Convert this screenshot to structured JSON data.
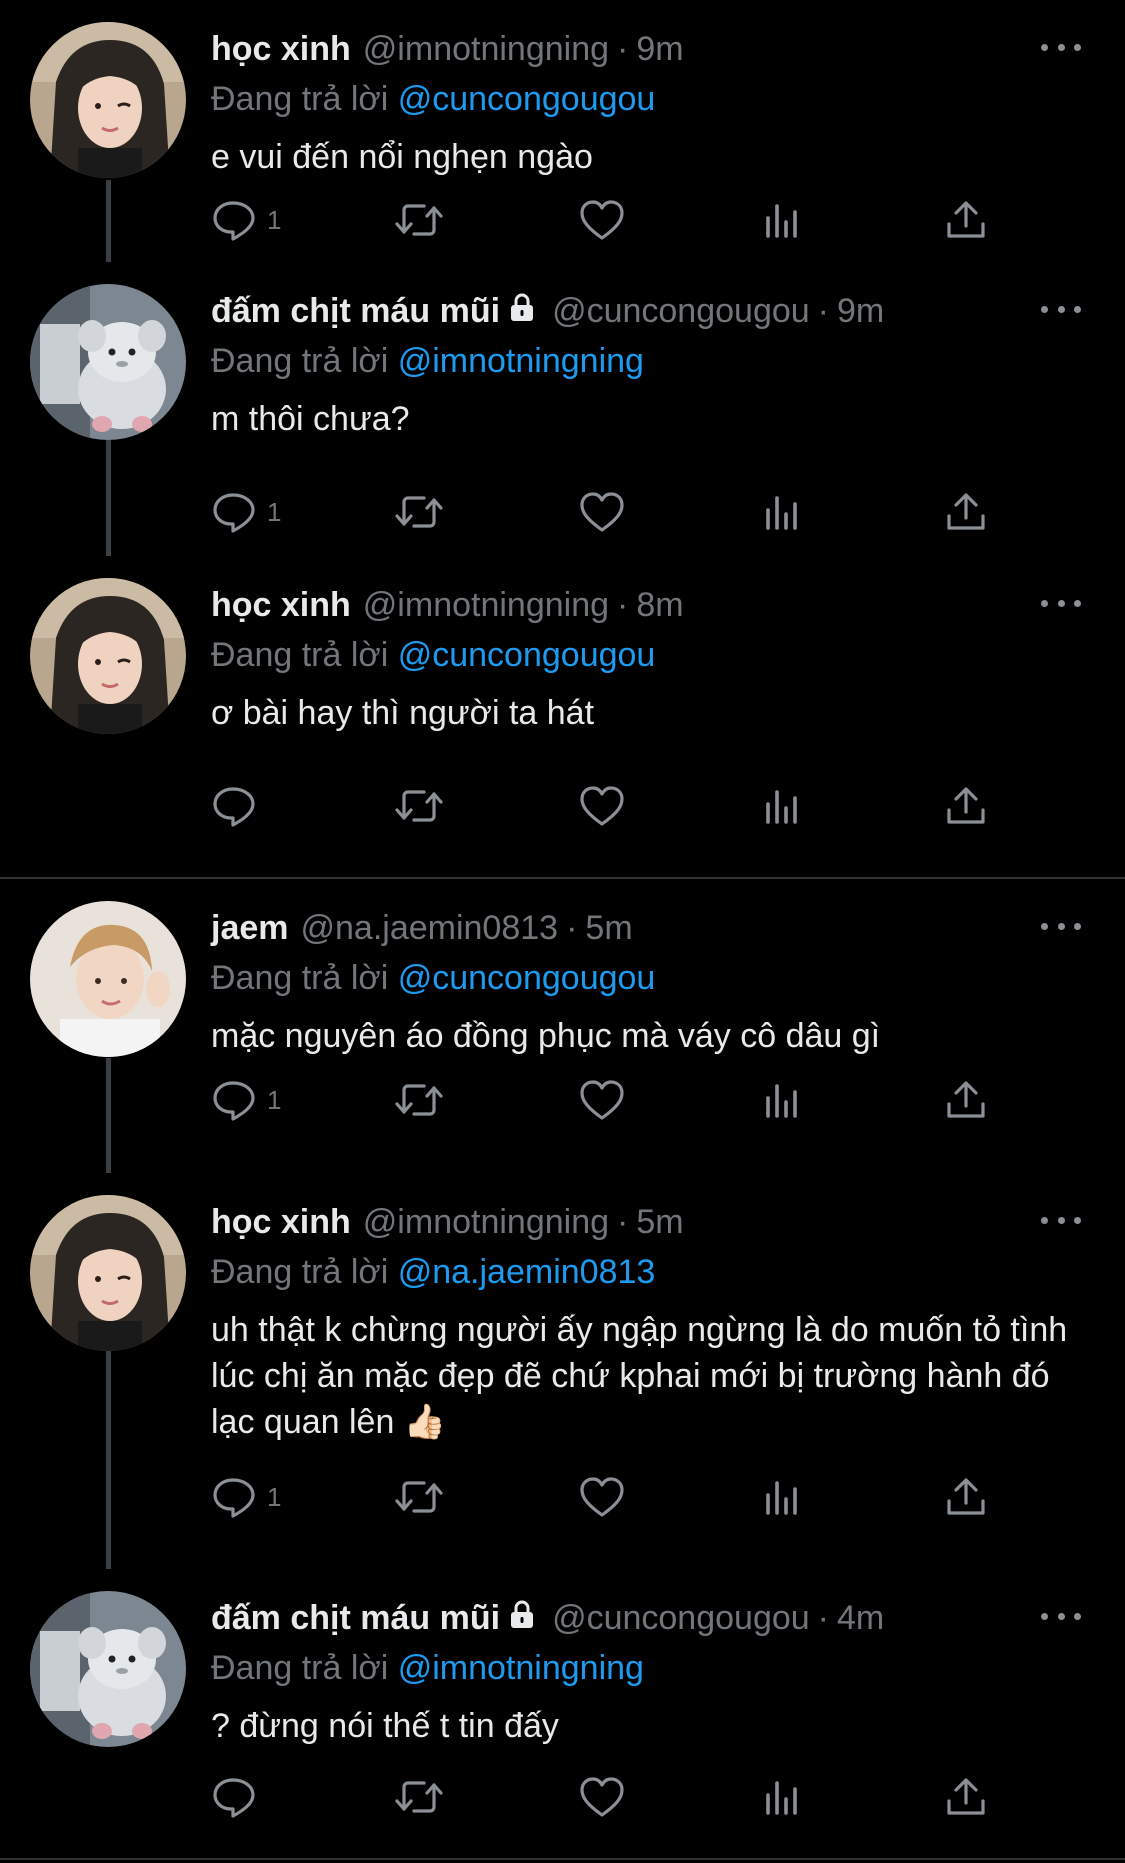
{
  "labels": {
    "replying_to": "Đang trả lời"
  },
  "colors": {
    "background": "#000000",
    "text": "#e7e9ea",
    "muted": "#71767b",
    "link": "#1d9bf0"
  },
  "tweets": [
    {
      "name": "học xinh",
      "handle": "@imnotningning",
      "time": "9m",
      "locked": false,
      "reply_to": "@cuncongougou",
      "text": "e vui đến nổi nghẹn ngào",
      "reply_count": "1",
      "avatar": "girl-long-hair-avatar"
    },
    {
      "name": "đấm chịt máu mũi",
      "handle": "@cuncongougou",
      "time": "9m",
      "locked": true,
      "reply_to": "@imnotningning",
      "text": "m thôi chưa?",
      "reply_count": "1",
      "avatar": "plush-toy-avatar"
    },
    {
      "name": "học xinh",
      "handle": "@imnotningning",
      "time": "8m",
      "locked": false,
      "reply_to": "@cuncongougou",
      "text": "ơ bài hay thì người ta hát",
      "reply_count": "",
      "avatar": "girl-long-hair-avatar"
    },
    {
      "name": "jaem",
      "handle": "@na.jaemin0813",
      "time": "5m",
      "locked": false,
      "reply_to": "@cuncongougou",
      "text": "mặc nguyên áo đồng phục mà váy cô dâu gì",
      "reply_count": "1",
      "avatar": "boy-light-hair-avatar"
    },
    {
      "name": "học xinh",
      "handle": "@imnotningning",
      "time": "5m",
      "locked": false,
      "reply_to": "@na.jaemin0813",
      "text": "uh thật k chừng người ấy ngập ngừng là do muốn tỏ tình lúc chị ăn mặc đẹp đẽ chứ kphai mới bị trường hành đó lạc quan lên 👍🏻",
      "reply_count": "1",
      "avatar": "girl-long-hair-avatar"
    },
    {
      "name": "đấm chịt máu mũi",
      "handle": "@cuncongougou",
      "time": "4m",
      "locked": true,
      "reply_to": "@imnotningning",
      "text": "? đừng nói thế t tin đấy",
      "reply_count": "",
      "avatar": "plush-toy-avatar"
    }
  ]
}
